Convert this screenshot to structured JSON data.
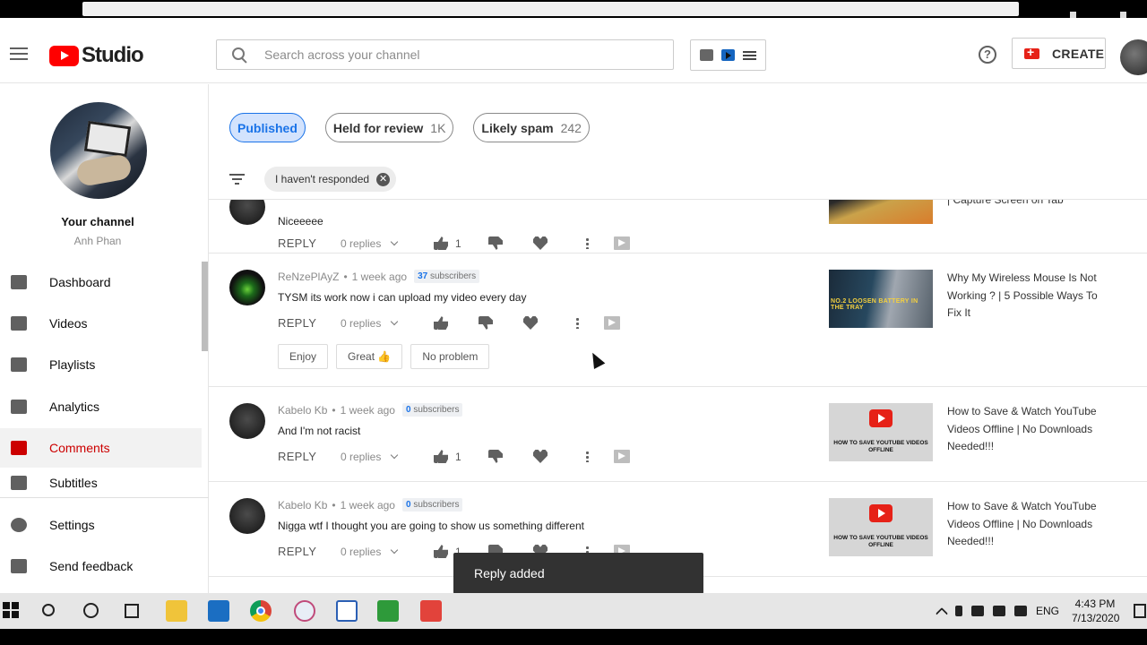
{
  "header": {
    "app_name": "Studio",
    "search_placeholder": "Search across your channel",
    "help_label": "?",
    "create_label": "CREATE"
  },
  "channel": {
    "title": "Your channel",
    "owner": "Anh Phan"
  },
  "sidebar": {
    "items": [
      {
        "label": "Dashboard",
        "icon": "dashboard-icon"
      },
      {
        "label": "Videos",
        "icon": "videos-icon"
      },
      {
        "label": "Playlists",
        "icon": "playlists-icon"
      },
      {
        "label": "Analytics",
        "icon": "analytics-icon"
      },
      {
        "label": "Comments",
        "icon": "comments-icon",
        "active": true
      },
      {
        "label": "Subtitles",
        "icon": "subtitles-icon"
      },
      {
        "label": "Settings",
        "icon": "gear-icon"
      },
      {
        "label": "Send feedback",
        "icon": "feedback-icon"
      }
    ]
  },
  "tabs": [
    {
      "label": "Published",
      "count": "",
      "active": true
    },
    {
      "label": "Held for review",
      "count": "1K"
    },
    {
      "label": "Likely spam",
      "count": "242"
    }
  ],
  "filter": {
    "chip_label": "I haven't responded",
    "clear": "✕"
  },
  "comments": [
    {
      "author": "",
      "time": "",
      "text": "Niceeeee",
      "reply_label": "REPLY",
      "replies": "0 replies",
      "likes": "1",
      "video_title": "| Capture Screen on Tab"
    },
    {
      "author": "ReNzePlAyZ",
      "time": "1 week ago",
      "subscribers": "37",
      "subscribers_label": "subscribers",
      "text": "TYSM its work now i can upload my video every day",
      "reply_label": "REPLY",
      "replies": "0 replies",
      "likes": "",
      "suggestions": [
        "Enjoy",
        "Great 👍",
        "No problem"
      ],
      "video_title": "Why My Wireless Mouse Is Not Working ? | 5 Possible Ways To Fix It",
      "thumb_text": "NO.2 LOOSEN BATTERY IN THE TRAY"
    },
    {
      "author": "Kabelo Kb",
      "time": "1 week ago",
      "subscribers": "0",
      "subscribers_label": "subscribers",
      "text": "And I'm not racist",
      "reply_label": "REPLY",
      "replies": "0 replies",
      "likes": "1",
      "video_title": "How to Save & Watch YouTube Videos Offline | No Downloads Needed!!!",
      "thumb_text": "HOW TO SAVE YOUTUBE VIDEOS OFFLINE"
    },
    {
      "author": "Kabelo Kb",
      "time": "1 week ago",
      "subscribers": "0",
      "subscribers_label": "subscribers",
      "text": "Nigga wtf I thought you are going to show us something different",
      "reply_label": "REPLY",
      "replies": "0 replies",
      "likes": "1",
      "video_title": "How to Save & Watch YouTube Videos Offline | No Downloads Needed!!!",
      "thumb_text": "HOW TO SAVE YOUTUBE VIDEOS OFFLINE"
    }
  ],
  "toast": "Reply added",
  "taskbar": {
    "language": "ENG",
    "time": "4:43 PM",
    "date": "7/13/2020"
  },
  "colors": {
    "accent_red": "#cc0000",
    "active_chip_bg": "#d3e3fd",
    "active_chip_fg": "#1a73e8",
    "toast_bg": "#323232"
  }
}
